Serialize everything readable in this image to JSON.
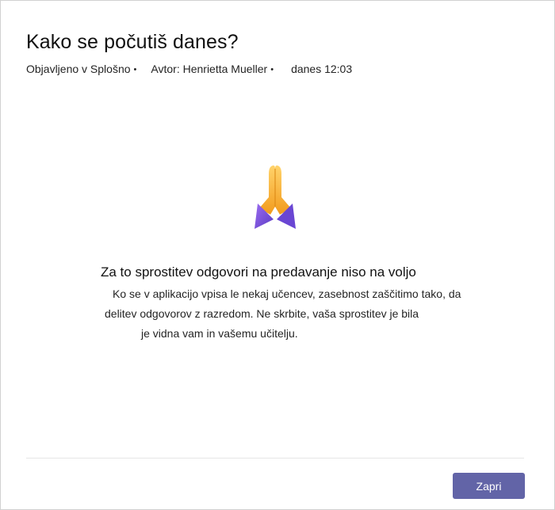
{
  "dialog": {
    "title": "Kako se počutiš danes?",
    "meta": {
      "posted_in": "Objavljeno v Splošno",
      "author": "Avtor: Henrietta Mueller",
      "time": "danes 12:03",
      "separator": "•"
    },
    "icon": "praying-hands-icon",
    "message": {
      "title": "Za to sprostitev odgovori na predavanje niso na voljo",
      "lines": [
        "Ko se v aplikacijo vpisa le nekaj učencev, zasebnost zaščitimo tako, da",
        "delitev odgovorov z razredom. Ne skrbite, vaša sprostitev je bila",
        "je vidna vam in vašemu učitelju."
      ]
    },
    "footer": {
      "close_label": "Zapri"
    }
  },
  "colors": {
    "accent": "#6264a7",
    "icon_orange": "#f5a623",
    "icon_purple": "#7b4fd6"
  }
}
